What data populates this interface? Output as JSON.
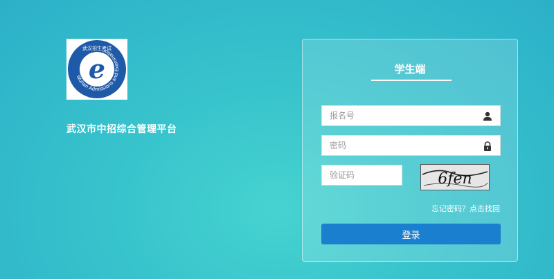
{
  "brand": {
    "platform_title": "武汉市中招综合管理平台",
    "logo_letter": "e",
    "logo_arc_text": "Wuhan Admissions and Examination",
    "logo_top_text": "武汉招生考试"
  },
  "login": {
    "panel_title": "学生端",
    "username_placeholder": "报名号",
    "password_placeholder": "密码",
    "captcha_placeholder": "验证码",
    "captcha_text": "6fen",
    "forgot_link": "忘记密码？点击找回",
    "submit_label": "登录"
  },
  "icons": {
    "username": "user-icon",
    "password": "lock-icon"
  },
  "colors": {
    "background": "#38c4cc",
    "primary_button": "#1a7fcf",
    "logo_blue": "#1e5aa8"
  }
}
